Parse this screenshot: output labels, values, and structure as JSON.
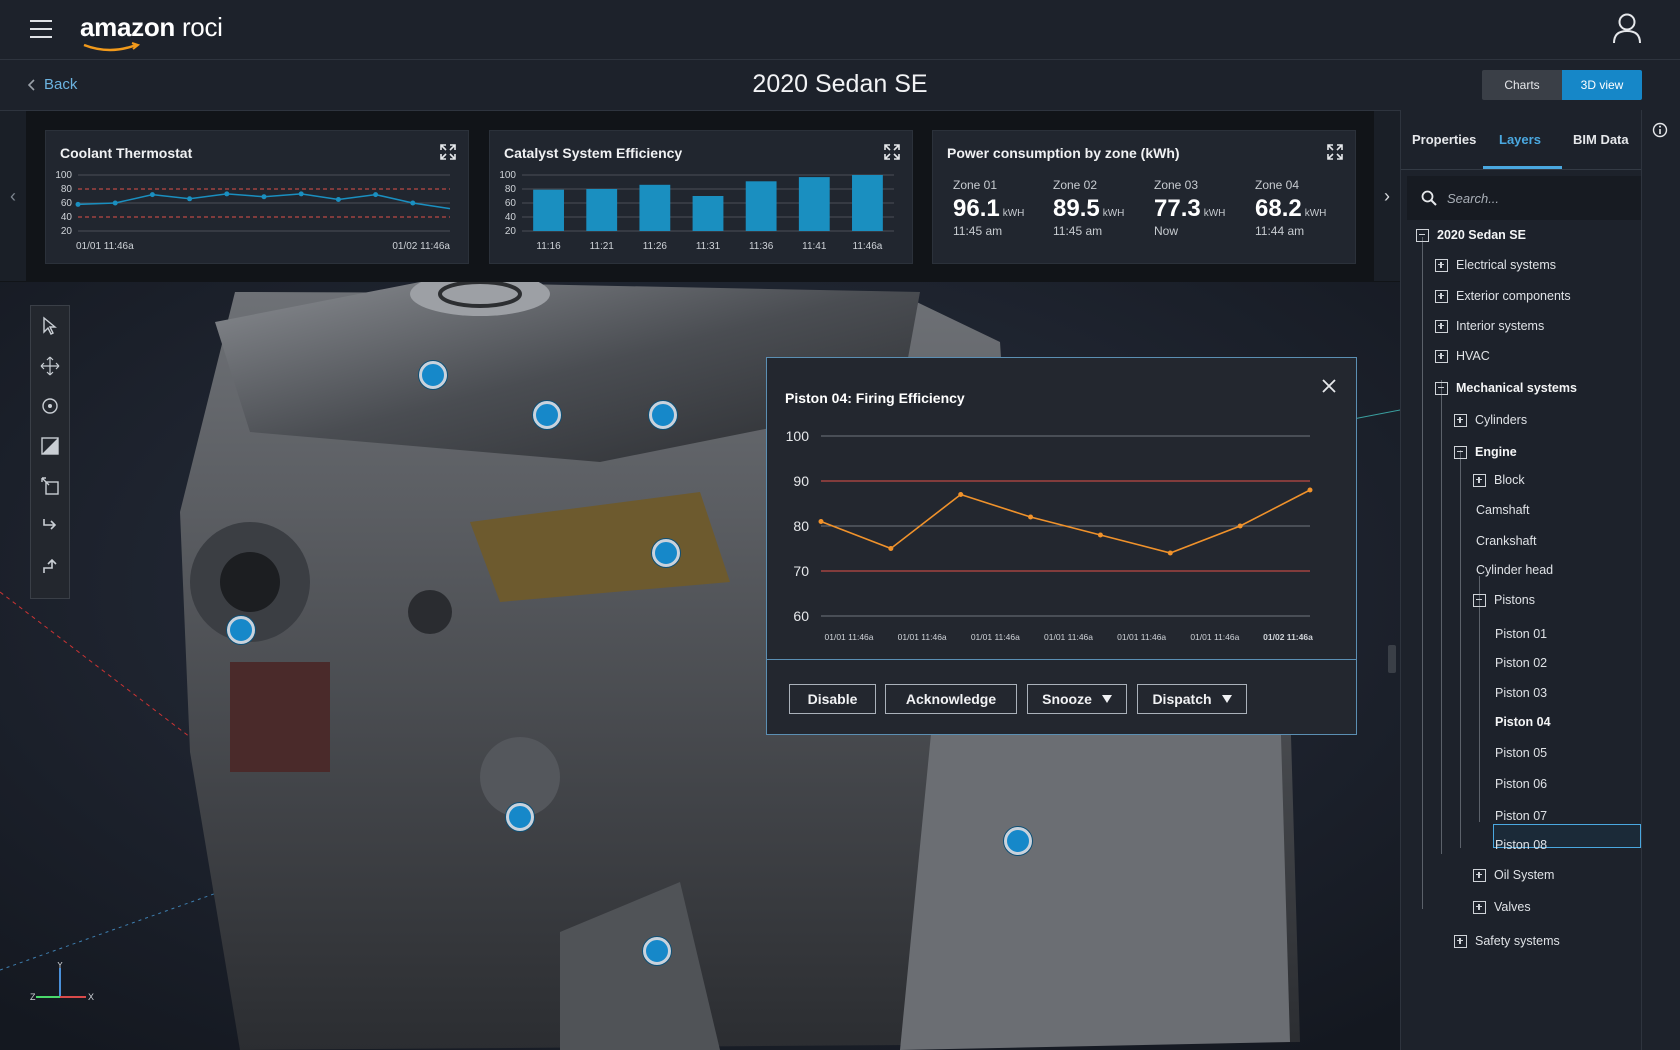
{
  "app": {
    "brand_bold": "amazon",
    "brand_light": "roci"
  },
  "header": {
    "back_label": "Back",
    "title": "2020 Sedan SE",
    "views": [
      "Charts",
      "3D view"
    ],
    "active_view": "3D view"
  },
  "cards": {
    "coolant": {
      "title": "Coolant Thermostat",
      "y_ticks": [
        "100",
        "80",
        "60",
        "40",
        "20"
      ],
      "x_start": "01/01 11:46a",
      "x_end": "01/02 11:46a"
    },
    "catalyst": {
      "title": "Catalyst System Efficiency",
      "y_ticks": [
        "100",
        "80",
        "60",
        "40",
        "20"
      ],
      "categories": [
        "11:16",
        "11:21",
        "11:26",
        "11:31",
        "11:36",
        "11:41",
        "11:46a"
      ]
    },
    "power": {
      "title": "Power consumption by zone (kWh)",
      "unit": "kWH",
      "zones": [
        {
          "label": "Zone 01",
          "value": "96.1",
          "time": "11:45 am"
        },
        {
          "label": "Zone 02",
          "value": "89.5",
          "time": "11:45 am"
        },
        {
          "label": "Zone 03",
          "value": "77.3",
          "time": "Now"
        },
        {
          "label": "Zone 04",
          "value": "68.2",
          "time": "11:44 am"
        }
      ]
    }
  },
  "chart_data": [
    {
      "type": "line",
      "title": "Coolant Thermostat",
      "x": [
        "01/01 11:46a",
        "",
        "",
        "",
        "",
        "",
        "",
        "",
        "",
        "01/02 11:46a"
      ],
      "values": [
        58,
        60,
        72,
        66,
        73,
        69,
        73,
        65,
        72,
        60,
        52
      ],
      "ylim": [
        20,
        100
      ],
      "thresholds": [
        80,
        40
      ],
      "grid": true
    },
    {
      "type": "bar",
      "title": "Catalyst System Efficiency",
      "categories": [
        "11:16",
        "11:21",
        "11:26",
        "11:31",
        "11:36",
        "11:41",
        "11:46a"
      ],
      "values": [
        79,
        80,
        86,
        70,
        91,
        97,
        100
      ],
      "ylim": [
        20,
        100
      ],
      "grid": true
    },
    {
      "type": "line",
      "title": "Piston 04: Firing Efficiency",
      "categories": [
        "01/01 11:46a",
        "01/01 11:46a",
        "01/01 11:46a",
        "01/01 11:46a",
        "01/01 11:46a",
        "01/01 11:46a",
        "01/02 11:46a"
      ],
      "values": [
        81,
        75,
        87,
        82,
        78,
        74,
        80,
        88
      ],
      "ylim": [
        60,
        100
      ],
      "y_ticks": [
        "100",
        "90",
        "80",
        "70",
        "60"
      ],
      "thresholds": [
        90,
        70
      ],
      "grid": true
    }
  ],
  "popup": {
    "title": "Piston 04: Firing Efficiency",
    "buttons": {
      "disable": "Disable",
      "acknowledge": "Acknowledge",
      "snooze": "Snooze",
      "dispatch": "Dispatch"
    }
  },
  "sidebar": {
    "tabs": [
      "Properties",
      "Layers",
      "BIM Data"
    ],
    "active_tab": "Layers",
    "search_placeholder": "Search...",
    "tree": {
      "root": "2020 Sedan SE",
      "electrical": "Electrical systems",
      "exterior": "Exterior components",
      "interior": "Interior systems",
      "hvac": "HVAC",
      "mechanical": "Mechanical systems",
      "cylinders": "Cylinders",
      "engine": "Engine",
      "block": "Block",
      "camshaft": "Camshaft",
      "crankshaft": "Crankshaft",
      "cylinder_head": "Cylinder head",
      "pistons": "Pistons",
      "p1": "Piston 01",
      "p2": "Piston 02",
      "p3": "Piston 03",
      "p4": "Piston 04",
      "p5": "Piston 05",
      "p6": "Piston 06",
      "p7": "Piston 07",
      "p8": "Piston 08",
      "oil": "Oil System",
      "valves": "Valves",
      "safety": "Safety systems"
    },
    "selected": "Piston 04"
  },
  "colors": {
    "accent": "#1687c8",
    "line_orange": "#f0922b",
    "threshold_red": "#e0504a",
    "bar_blue": "#1a8fc0"
  }
}
